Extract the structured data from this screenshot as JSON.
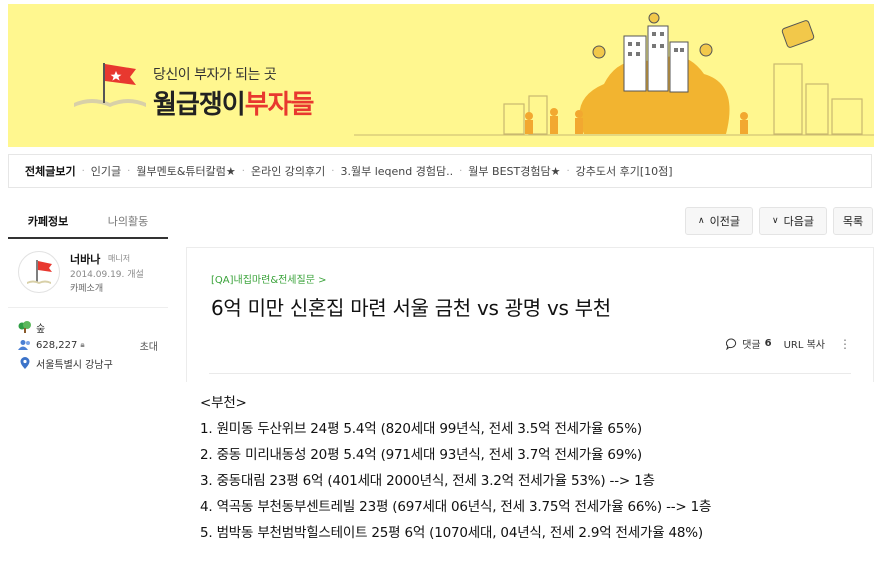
{
  "banner": {
    "tagline": "당신이 부자가 되는 곳",
    "title_part1": "월급쟁이",
    "title_part2": "부자들"
  },
  "nav": {
    "items": [
      "전체글보기",
      "인기글",
      "월부멘토&튜터칼럼★",
      "온라인 강의후기",
      "3.월부 leqend 경험담..",
      "월부 BEST경험담★",
      "강추도서 후기[10점]"
    ]
  },
  "sidebar": {
    "tabs": [
      "카페정보",
      "나의활동"
    ],
    "profile": {
      "name": "너바나",
      "role": "매니저",
      "date": "2014.09.19. 개설",
      "intro": "카페소개"
    },
    "stats": {
      "level": "숲",
      "members": "628,227",
      "invite": "초대",
      "location": "서울특별시 강남구"
    }
  },
  "toolbar": {
    "prev": "이전글",
    "next": "다음글",
    "list": "목록"
  },
  "article": {
    "category": "[QA]내집마련&전세질문 >",
    "title": "6억 미만 신혼집 마련 서울 금천 vs 광명 vs 부천",
    "comment_label": "댓글",
    "comment_count": "6",
    "url_copy": "URL 복사"
  },
  "body": {
    "lines": [
      "<부천>",
      "1. 원미동 두산위브 24평 5.4억 (820세대 99년식, 전세 3.5억 전세가율 65%)",
      "2. 중동 미리내동성 20평 5.4억 (971세대 93년식, 전세 3.7억 전세가율 69%)",
      "3. 중동대림 23평 6억 (401세대 2000년식, 전세 3.2억 전세가율 53%) --> 1층",
      "4. 역곡동 부천동부센트레빌 23평 (697세대 06년식, 전세 3.75억 전세가율 66%) --> 1층",
      "5. 범박동 부천범박힐스테이트 25평 6억 (1070세대, 04년식, 전세 2.9억 전세가율 48%)"
    ]
  },
  "colors": {
    "banner_bg": "#fff78f",
    "brand_red": "#e8382f",
    "category_green": "#3aa33a"
  }
}
